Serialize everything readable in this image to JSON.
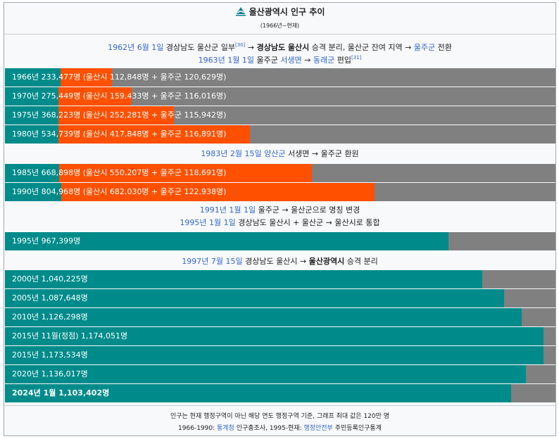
{
  "header": {
    "title": "울산광역시 인구 추이",
    "subtitle": "(1966년~현재)"
  },
  "notes": {
    "n1": {
      "date": "1962년 6월 1일",
      "text1": " 경상남도 울산군 일부",
      "ref": "[30]",
      "text2": " → ",
      "bold": "경상남도 울산시",
      "text3": " 승격 분리, 울산군 잔여 지역 → ",
      "link": "울주군",
      "text4": " 전환"
    },
    "n2": {
      "date": "1963년 1월 1일",
      "text1": " 울주군 ",
      "link1": "서생면",
      "text2": " → ",
      "link2": "동래군",
      "text3": " 편입",
      "ref": "[31]"
    },
    "n3": {
      "date": "1983년 2월 15일",
      "text1": " ",
      "link": "양산군",
      "text2": " 서생면 → 울주군 환원"
    },
    "n4": {
      "date": "1991년 1월 1일",
      "text": " 울주군 → 울산군으로 명칭 변경"
    },
    "n5": {
      "date": "1995년 1월 1일",
      "text": " 경상남도 울산시 + 울산군 → 울산시로 통합"
    },
    "n6": {
      "date": "1997년 7월 15일",
      "text1": " 경상남도 울산시 → ",
      "bold": "울산광역시",
      "text2": " 승격 분리"
    }
  },
  "colors": {
    "combined": "#008b8b",
    "city": "#ff5000",
    "max_remainder": "#808080"
  },
  "chart_data": {
    "type": "bar",
    "scale_max": 1200000,
    "series": [
      {
        "name": "울산시",
        "values": [
          112848,
          159433,
          252281,
          417848,
          550207,
          682030,
          null,
          null,
          null,
          null,
          null,
          null,
          null,
          null
        ]
      },
      {
        "name": "울주군",
        "values": [
          120629,
          116016,
          115942,
          116891,
          118691,
          122938,
          null,
          null,
          null,
          null,
          null,
          null,
          null,
          null
        ]
      }
    ],
    "rows": [
      {
        "label": "1966년 233,477명 (울산시 112,848명 + 울주군 120,629명)",
        "total": 233477,
        "city": 112848
      },
      {
        "label": "1970년 275,449명 (울산시 159,433명 + 울주군 116,016명)",
        "total": 275449,
        "city": 159433
      },
      {
        "label": "1975년 368,223명 (울산시 252,281명 + 울주군 115,942명)",
        "total": 368223,
        "city": 252281
      },
      {
        "label": "1980년 534,739명 (울산시 417,848명 + 울주군 116,891명)",
        "total": 534739,
        "city": 417848
      },
      {
        "label": "1985년 668,898명 (울산시 550,207명 + 울주군 118,691명)",
        "total": 668898,
        "city": 550207
      },
      {
        "label": "1990년 804,968명 (울산시 682,030명 + 울주군 122,938명)",
        "total": 804968,
        "city": 682030
      },
      {
        "label": "1995년 967,399명",
        "total": 967399
      },
      {
        "label": "2000년 1,040,225명",
        "total": 1040225
      },
      {
        "label": "2005년 1,087,648명",
        "total": 1087648
      },
      {
        "label": "2010년 1,126,298명",
        "total": 1126298
      },
      {
        "label": "2015년 11월(정점) 1,174,051명",
        "total": 1174051
      },
      {
        "label": "2015년 1,173,534명",
        "total": 1173534
      },
      {
        "label": "2020년 1,136,017명",
        "total": 1136017
      },
      {
        "label": "2024년 1월 1,103,402명",
        "total": 1103402,
        "bold": true
      }
    ]
  },
  "footer": {
    "line1": "인구는 현재 행정구역이 아닌 해당 연도 행정구역 기준, 그래프 최대 값은 120만 명",
    "line2_a": "1966-1990: ",
    "line2_link1": "통계청",
    "line2_b": " 인구총조사, 1995-현재: ",
    "line2_link2": "행정안전부",
    "line2_c": " 주민등록인구통계"
  }
}
